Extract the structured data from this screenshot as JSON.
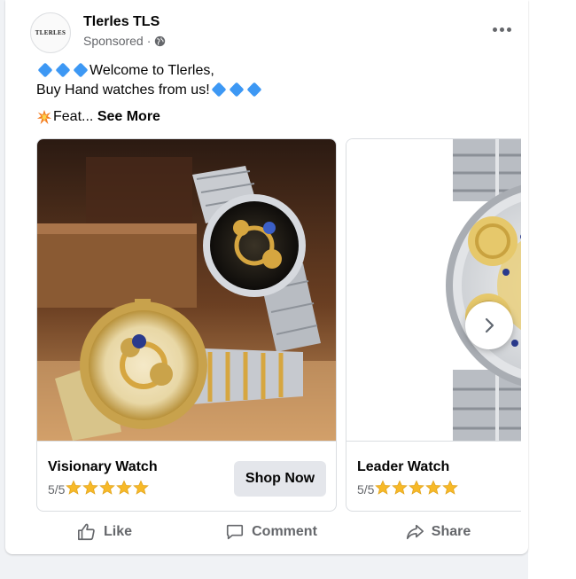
{
  "post": {
    "page_name": "Tlerles TLS",
    "avatar_text": "TLERLES",
    "sponsored_label": "Sponsored",
    "separator": "·",
    "line1": "Welcome to Tlerles,",
    "line2": "Buy  Hand watches from us!",
    "truncated_text": "Feat...",
    "see_more": "See More"
  },
  "carousel": {
    "items": [
      {
        "title": "Visionary Watch",
        "rating": "5/5",
        "stars": 5,
        "cta": "Shop Now"
      },
      {
        "title": "Leader Watch",
        "rating": "5/5",
        "stars": 5
      }
    ]
  },
  "actions": {
    "like": "Like",
    "comment": "Comment",
    "share": "Share"
  },
  "icons": {
    "more": "more-horizontal-icon",
    "audience": "globe-icon",
    "next": "chevron-right-icon",
    "star": "star-icon",
    "diamond": "blue-diamond-icon",
    "burst": "collision-icon"
  },
  "colors": {
    "text": "#050505",
    "secondary": "#65676b",
    "button_bg": "#e4e6eb",
    "diamond": "#3d98f4",
    "star": "#f7b928"
  }
}
